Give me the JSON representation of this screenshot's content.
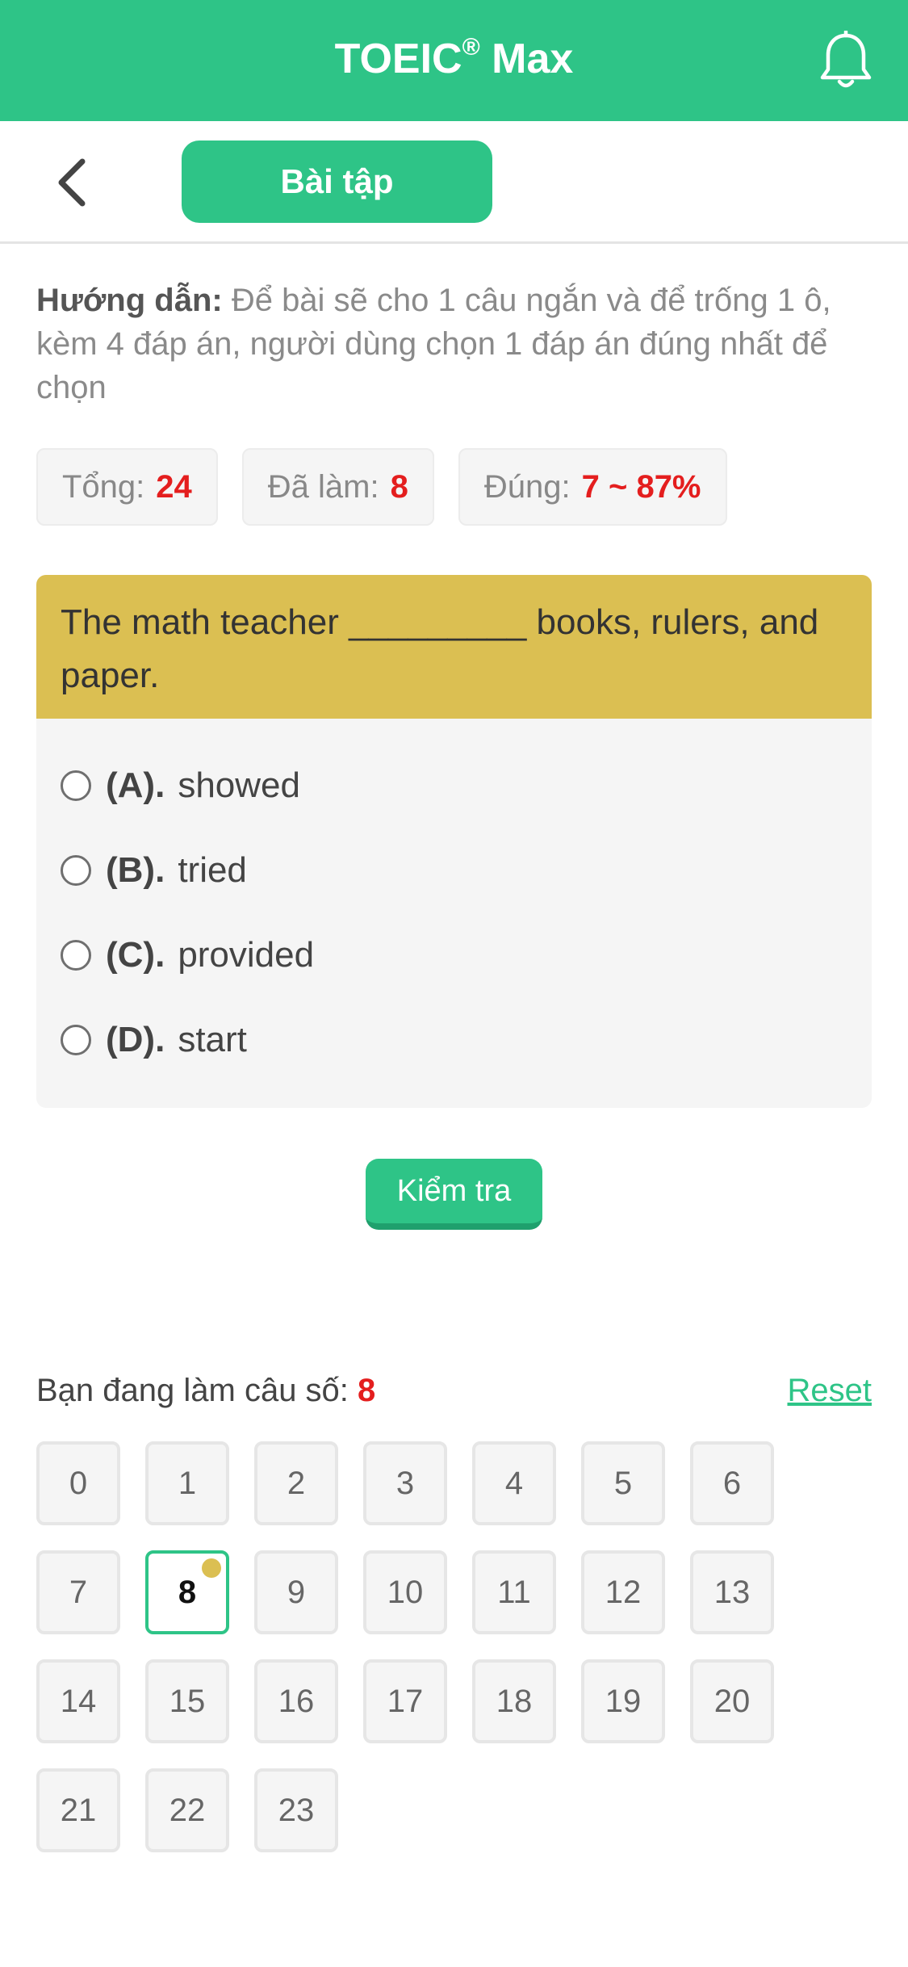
{
  "app": {
    "title": "TOEIC",
    "title_reg": "®",
    "title_suffix": " Max"
  },
  "header": {
    "tab_label": "Bài tập"
  },
  "instruction": {
    "label": "Hướng dẫn:",
    "text": " Để bài sẽ cho 1 câu ngắn và để trống 1 ô, kèm 4 đáp án, người dùng chọn 1 đáp án đúng nhất để chọn"
  },
  "stats": {
    "total_label": "Tổng:",
    "total_value": "24",
    "done_label": "Đã làm:",
    "done_value": "8",
    "correct_label": "Đúng:",
    "correct_value": "7 ~ 87%"
  },
  "question": {
    "text": "The math teacher _________ books, rulers, and paper.",
    "options": [
      {
        "key": "(A).",
        "text": "showed"
      },
      {
        "key": "(B).",
        "text": "tried"
      },
      {
        "key": "(C).",
        "text": "provided"
      },
      {
        "key": "(D).",
        "text": "start"
      }
    ]
  },
  "check_button": "Kiểm tra",
  "progress": {
    "label": "Bạn đang làm câu số: ",
    "current": "8",
    "reset": "Reset"
  },
  "question_numbers": [
    "0",
    "1",
    "2",
    "3",
    "4",
    "5",
    "6",
    "7",
    "8",
    "9",
    "10",
    "11",
    "12",
    "13",
    "14",
    "15",
    "16",
    "17",
    "18",
    "19",
    "20",
    "21",
    "22",
    "23"
  ],
  "active_index": 8,
  "colors": {
    "primary": "#2ec487",
    "question_header": "#dbbf52",
    "highlight": "#e41e1e"
  }
}
